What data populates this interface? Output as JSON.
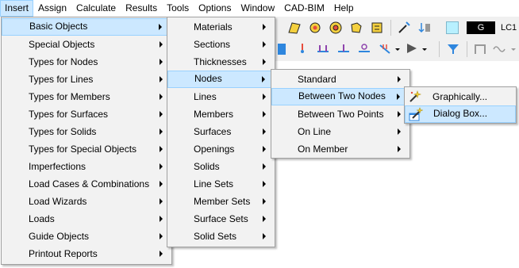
{
  "menubar": {
    "items": [
      "Insert",
      "Assign",
      "Calculate",
      "Results",
      "Tools",
      "Options",
      "Window",
      "CAD-BIM",
      "Help"
    ],
    "active": "Insert"
  },
  "toolbar": {
    "load_case_color": "#b8f0ff",
    "load_case_group": "G",
    "load_case_label": "LC1"
  },
  "insert_menu": {
    "items": [
      {
        "label": "Basic Objects",
        "submenu": true,
        "highlighted": true
      },
      {
        "label": "Special Objects",
        "submenu": true
      },
      {
        "label": "Types for Nodes",
        "submenu": true
      },
      {
        "label": "Types for Lines",
        "submenu": true
      },
      {
        "label": "Types for Members",
        "submenu": true
      },
      {
        "label": "Types for Surfaces",
        "submenu": true
      },
      {
        "label": "Types for Solids",
        "submenu": true
      },
      {
        "label": "Types for Special Objects",
        "submenu": true
      },
      {
        "label": "Imperfections",
        "submenu": true
      },
      {
        "label": "Load Cases & Combinations",
        "submenu": true
      },
      {
        "label": "Load Wizards",
        "submenu": true
      },
      {
        "label": "Loads",
        "submenu": true
      },
      {
        "label": "Guide Objects",
        "submenu": true
      },
      {
        "label": "Printout Reports",
        "submenu": true
      }
    ]
  },
  "basic_objects_menu": {
    "items": [
      {
        "label": "Materials",
        "submenu": true
      },
      {
        "label": "Sections",
        "submenu": true
      },
      {
        "label": "Thicknesses",
        "submenu": true
      },
      {
        "label": "Nodes",
        "submenu": true,
        "highlighted": true
      },
      {
        "label": "Lines",
        "submenu": true
      },
      {
        "label": "Members",
        "submenu": true
      },
      {
        "label": "Surfaces",
        "submenu": true
      },
      {
        "label": "Openings",
        "submenu": true
      },
      {
        "label": "Solids",
        "submenu": true
      },
      {
        "label": "Line Sets",
        "submenu": true
      },
      {
        "label": "Member Sets",
        "submenu": true
      },
      {
        "label": "Surface Sets",
        "submenu": true
      },
      {
        "label": "Solid Sets",
        "submenu": true
      }
    ]
  },
  "nodes_menu": {
    "items": [
      {
        "label": "Standard",
        "submenu": true
      },
      {
        "label": "Between Two Nodes",
        "submenu": true,
        "highlighted": true
      },
      {
        "label": "Between Two Points",
        "submenu": true
      },
      {
        "label": "On Line",
        "submenu": true
      },
      {
        "label": "On Member",
        "submenu": true
      }
    ]
  },
  "between_two_nodes_menu": {
    "items": [
      {
        "label": "Graphically...",
        "icon": "magic-wand-icon"
      },
      {
        "label": "Dialog Box...",
        "icon": "dialog-wand-icon",
        "highlighted": true
      }
    ]
  }
}
